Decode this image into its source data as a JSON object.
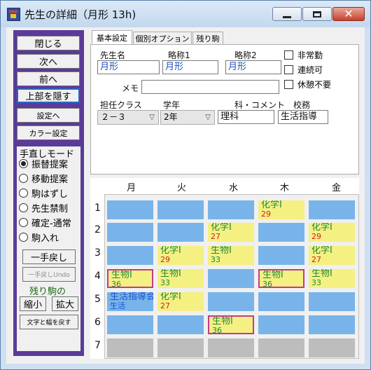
{
  "window": {
    "title": "先生の詳細（月形 13h)"
  },
  "left": {
    "buttons": [
      "閉じる",
      "次へ",
      "前へ",
      "上部を隠す",
      "設定へ",
      "カラー設定"
    ],
    "mode_title": "手直しモード",
    "modes": [
      "振替提案",
      "移動提案",
      "駒はずし",
      "先生禁制",
      "確定-通常",
      "駒入れ"
    ],
    "selected_mode": 0,
    "undo": "一手戻し",
    "undo_undo": "一手戻しUndo",
    "remain": "残り駒の",
    "shrink": "縮小",
    "expand": "拡大",
    "restore": "文字と幅を戻す"
  },
  "tabs": [
    "基本設定",
    "個別オプション",
    "残り駒"
  ],
  "form": {
    "name_label": "先生名",
    "name": "月形",
    "abbr1_label": "略称1",
    "abbr1": "月形",
    "abbr2_label": "略称2",
    "abbr2": "月形",
    "memo_label": "メモ",
    "memo": "",
    "class_label": "担任クラス",
    "class": "２－３",
    "grade_label": "学年",
    "grade": "2年",
    "subject_label": "科・コメント",
    "subject": "理科",
    "duty_label": "校務",
    "duty": "生活指導",
    "checks": [
      "非常勤",
      "連続可",
      "休憩不要"
    ]
  },
  "grid": {
    "days": [
      "月",
      "火",
      "水",
      "木",
      "金"
    ],
    "periods": [
      "1",
      "2",
      "3",
      "4",
      "5",
      "6",
      "7"
    ],
    "cells": [
      [
        {
          "t": "blue"
        },
        {
          "t": "blue"
        },
        {
          "t": "blue"
        },
        {
          "t": "yellow",
          "name": "化学Ⅰ",
          "sub": "29",
          "sc": "red"
        },
        {
          "t": "blue"
        }
      ],
      [
        {
          "t": "blue"
        },
        {
          "t": "blue"
        },
        {
          "t": "yellow",
          "name": "化学Ⅰ",
          "sub": "27",
          "sc": "red"
        },
        {
          "t": "blue"
        },
        {
          "t": "yellow",
          "name": "化学Ⅰ",
          "sub": "29",
          "sc": "red"
        }
      ],
      [
        {
          "t": "blue"
        },
        {
          "t": "yellow",
          "name": "化学Ⅰ",
          "sub": "29",
          "sc": "red"
        },
        {
          "t": "yellow",
          "name": "生物Ⅰ",
          "sub": "33",
          "sc": "green"
        },
        {
          "t": "blue"
        },
        {
          "t": "yellow",
          "name": "化学Ⅰ",
          "sub": "27",
          "sc": "red"
        }
      ],
      [
        {
          "t": "yellow",
          "name": "生物Ⅰ",
          "sub": "36",
          "sc": "green",
          "sel": true
        },
        {
          "t": "yellow",
          "name": "生物Ⅰ",
          "sub": "33",
          "sc": "green"
        },
        {
          "t": "blue"
        },
        {
          "t": "yellow",
          "name": "生物Ⅰ",
          "sub": "36",
          "sc": "green",
          "sel": true
        },
        {
          "t": "yellow",
          "name": "生物Ⅰ",
          "sub": "33",
          "sc": "green"
        }
      ],
      [
        {
          "t": "blue",
          "name": "生活指導会",
          "sub": "生活",
          "sc": "blue",
          "nc": "blue"
        },
        {
          "t": "yellow",
          "name": "化学Ⅰ",
          "sub": "27",
          "sc": "red"
        },
        {
          "t": "blue"
        },
        {
          "t": "blue"
        },
        {
          "t": "blue"
        }
      ],
      [
        {
          "t": "blue"
        },
        {
          "t": "blue"
        },
        {
          "t": "yellow",
          "name": "生物Ⅰ",
          "sub": "36",
          "sc": "green",
          "sel": true
        },
        {
          "t": "blue"
        },
        {
          "t": "blue"
        }
      ],
      [
        {
          "t": "grey"
        },
        {
          "t": "grey"
        },
        {
          "t": "grey"
        },
        {
          "t": "grey"
        },
        {
          "t": "grey"
        }
      ]
    ]
  }
}
